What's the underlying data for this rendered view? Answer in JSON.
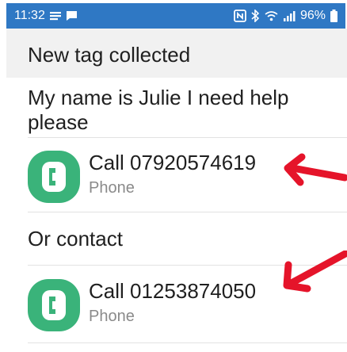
{
  "status_bar": {
    "time": "11:32",
    "battery": "96%",
    "background": "#2f78c4"
  },
  "header": {
    "title": "New tag collected"
  },
  "message": "My name is Julie I need help please",
  "primary_contact": {
    "title": "Call 07920574619",
    "subtitle": "Phone",
    "icon": "phone-app-icon"
  },
  "section_label": "Or contact",
  "secondary_contact": {
    "title": "Call 01253874050",
    "subtitle": "Phone",
    "icon": "phone-app-icon"
  },
  "colors": {
    "accent": "#2f78c4",
    "icon_green": "#3ab37a",
    "arrow_red": "#e5142a"
  }
}
